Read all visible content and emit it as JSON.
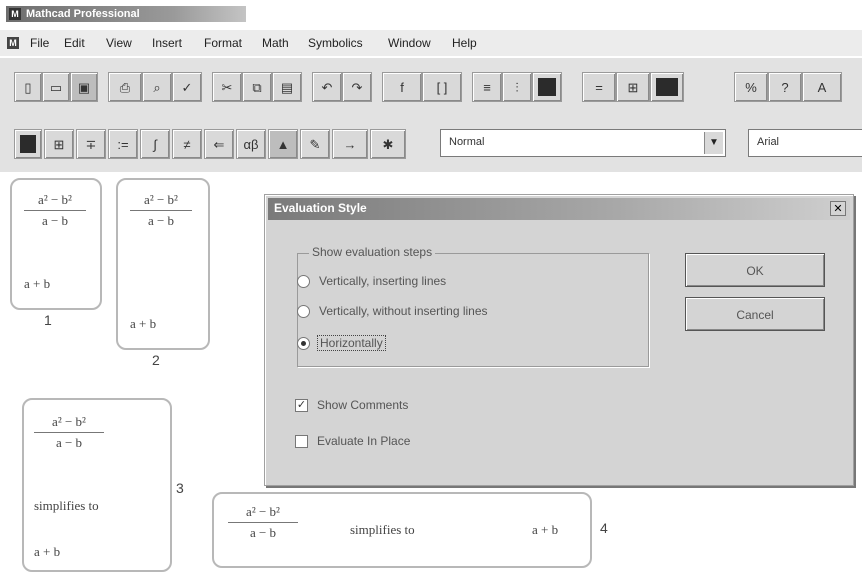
{
  "window": {
    "title": "Mathcad Professional",
    "app_icon": "mathcad-icon"
  },
  "menu": {
    "items": [
      "File",
      "Edit",
      "View",
      "Insert",
      "Format",
      "Math",
      "Symbolics",
      "Window",
      "Help"
    ]
  },
  "toolbar": {
    "style_select": "Normal",
    "font_select": "Arial"
  },
  "regions": [
    {
      "numerator": "a² − b²",
      "denominator": "a − b",
      "result": "a + b",
      "label": "1"
    },
    {
      "numerator": "a² − b²",
      "denominator": "a − b",
      "result": "a + b",
      "label": "2"
    },
    {
      "numerator": "a² − b²",
      "denominator": "a − b",
      "middle": "simplifies to",
      "result": "a + b",
      "label": "3"
    },
    {
      "numerator": "a² − b²",
      "denominator": "a − b",
      "middle": "simplifies to",
      "result": "a + b",
      "label": "4"
    }
  ],
  "dialog": {
    "title": "Evaluation Style",
    "group_label": "Show evaluation steps",
    "options": [
      {
        "label": "Vertically, inserting lines",
        "selected": false
      },
      {
        "label": "Vertically, without inserting lines",
        "selected": false
      },
      {
        "label": "Horizontally",
        "selected": true
      }
    ],
    "show_comments": {
      "label": "Show Comments",
      "checked": true
    },
    "evaluate_in_place": {
      "label": "Evaluate In Place",
      "checked": false
    },
    "ok_label": "OK",
    "cancel_label": "Cancel"
  }
}
